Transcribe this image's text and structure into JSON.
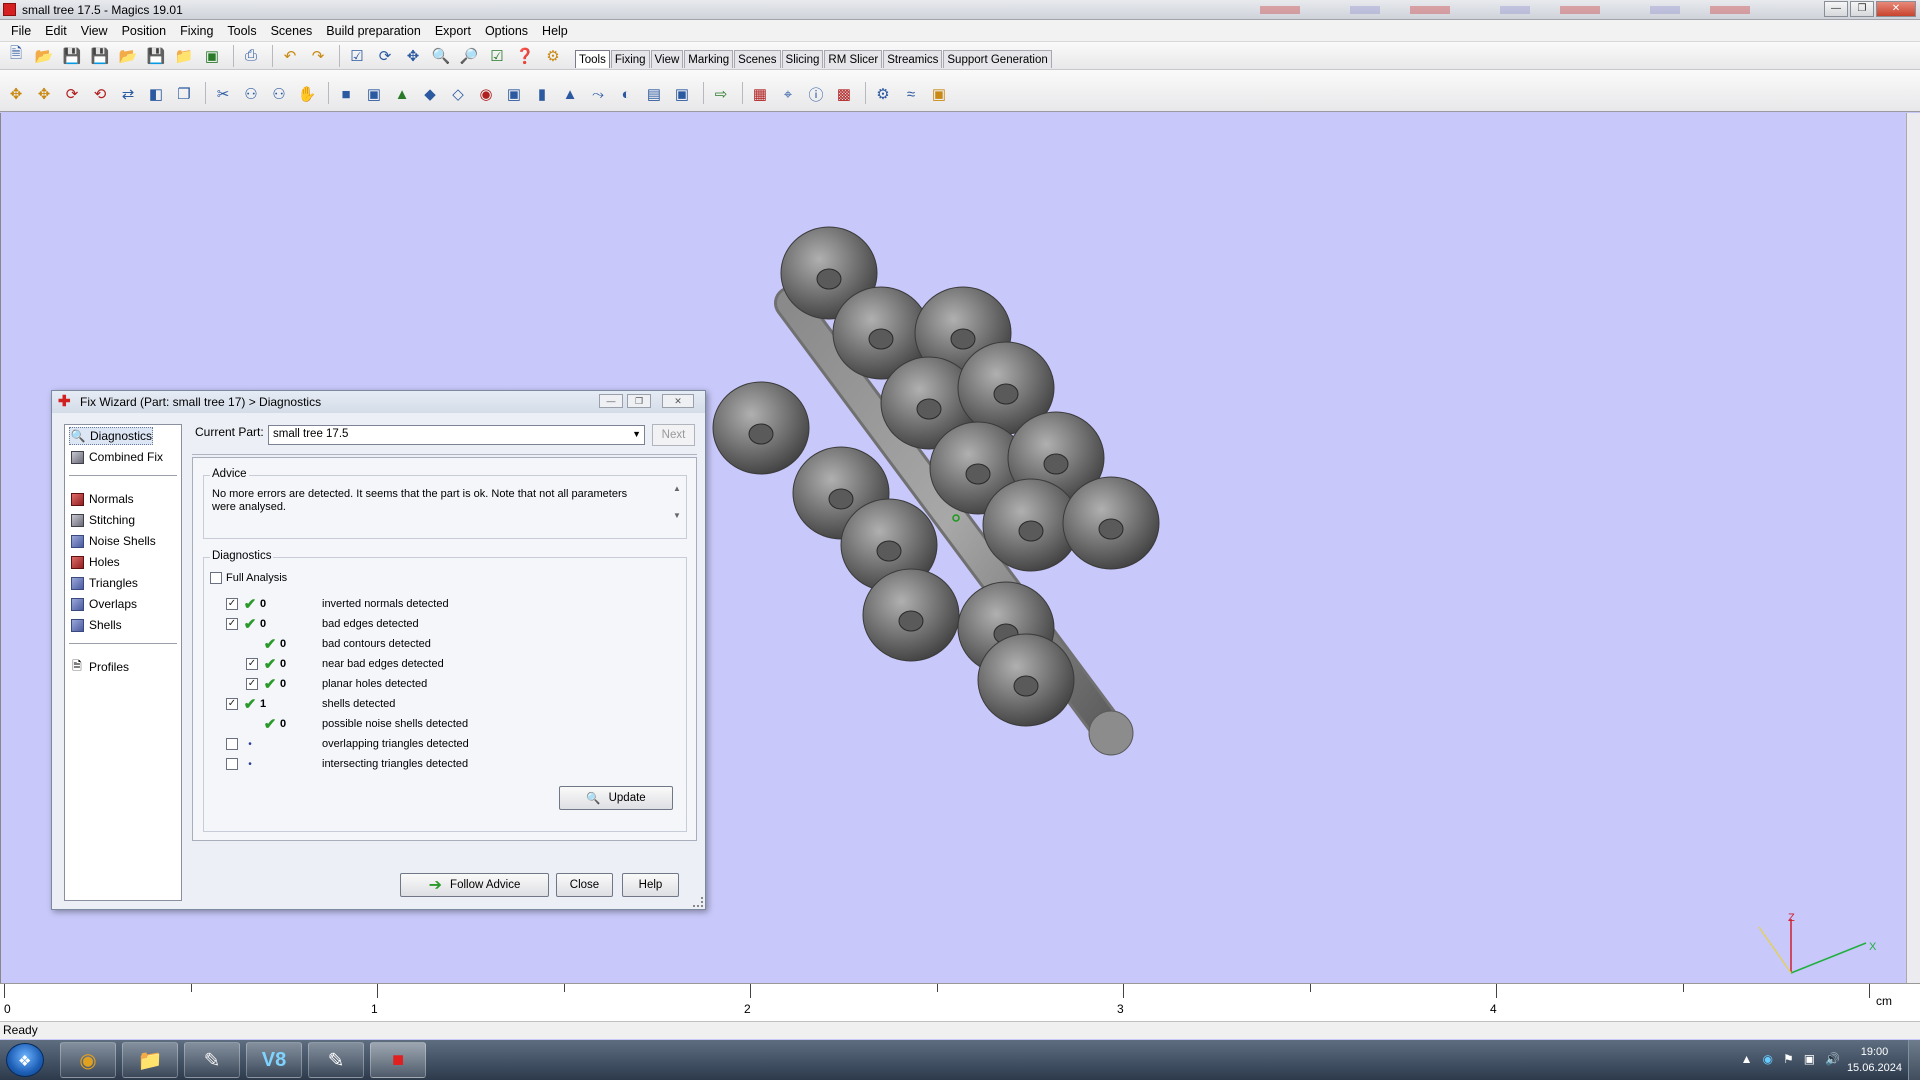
{
  "window": {
    "title": "small tree 17.5 - Magics 19.01"
  },
  "menu": [
    "File",
    "Edit",
    "View",
    "Position",
    "Fixing",
    "Tools",
    "Scenes",
    "Build preparation",
    "Export",
    "Options",
    "Help"
  ],
  "ribbon_tabs": [
    "Tools",
    "Fixing",
    "View",
    "Marking",
    "Scenes",
    "Slicing",
    "RM Slicer",
    "Streamics",
    "Support Generation"
  ],
  "ribbon_active": "Tools",
  "dialog": {
    "title": "Fix Wizard (Part: small tree 17) > Diagnostics",
    "nav_top": [
      "Diagnostics",
      "Combined Fix"
    ],
    "nav_tools": [
      "Normals",
      "Stitching",
      "Noise Shells",
      "Holes",
      "Triangles",
      "Overlaps",
      "Shells"
    ],
    "nav_bottom": [
      "Profiles"
    ],
    "current_part_label": "Current Part:",
    "current_part_value": "small tree 17.5",
    "next_label": "Next",
    "advice_label": "Advice",
    "advice_text": "No more errors are detected. It seems that the part is ok. Note that not all parameters were analysed.",
    "diagnostics_label": "Diagnostics",
    "full_analysis_label": "Full Analysis",
    "rows": [
      {
        "checked": true,
        "status": "ok",
        "count": "0",
        "label": "inverted normals detected",
        "indent": 0
      },
      {
        "checked": true,
        "status": "ok",
        "count": "0",
        "label": "bad edges detected",
        "indent": 0
      },
      {
        "checked": null,
        "status": "ok",
        "count": "0",
        "label": "bad contours detected",
        "indent": 1
      },
      {
        "checked": true,
        "status": "ok",
        "count": "0",
        "label": "near bad edges detected",
        "indent": 1
      },
      {
        "checked": true,
        "status": "ok",
        "count": "0",
        "label": "planar holes detected",
        "indent": 1
      },
      {
        "checked": true,
        "status": "ok",
        "count": "1",
        "label": "shells detected",
        "indent": 0
      },
      {
        "checked": null,
        "status": "ok",
        "count": "0",
        "label": "possible noise shells detected",
        "indent": 1
      },
      {
        "checked": false,
        "status": "dot",
        "count": "",
        "label": "overlapping triangles detected",
        "indent": 0
      },
      {
        "checked": false,
        "status": "dot",
        "count": "",
        "label": "intersecting triangles detected",
        "indent": 0
      }
    ],
    "update_label": "Update",
    "follow_advice_label": "Follow Advice",
    "close_label": "Close",
    "help_label": "Help"
  },
  "ruler": {
    "labels": [
      "0",
      "1",
      "2",
      "3",
      "4"
    ],
    "unit": "cm"
  },
  "axes": {
    "z": "Z",
    "x": "X"
  },
  "status": "Ready",
  "clock": {
    "time": "19:00",
    "date": "15.06.2024"
  },
  "taskbar_apps": [
    "chrome-icon",
    "folder-icon",
    "paint-icon",
    "v8-icon",
    "magics-icon",
    "acrobat-icon"
  ]
}
